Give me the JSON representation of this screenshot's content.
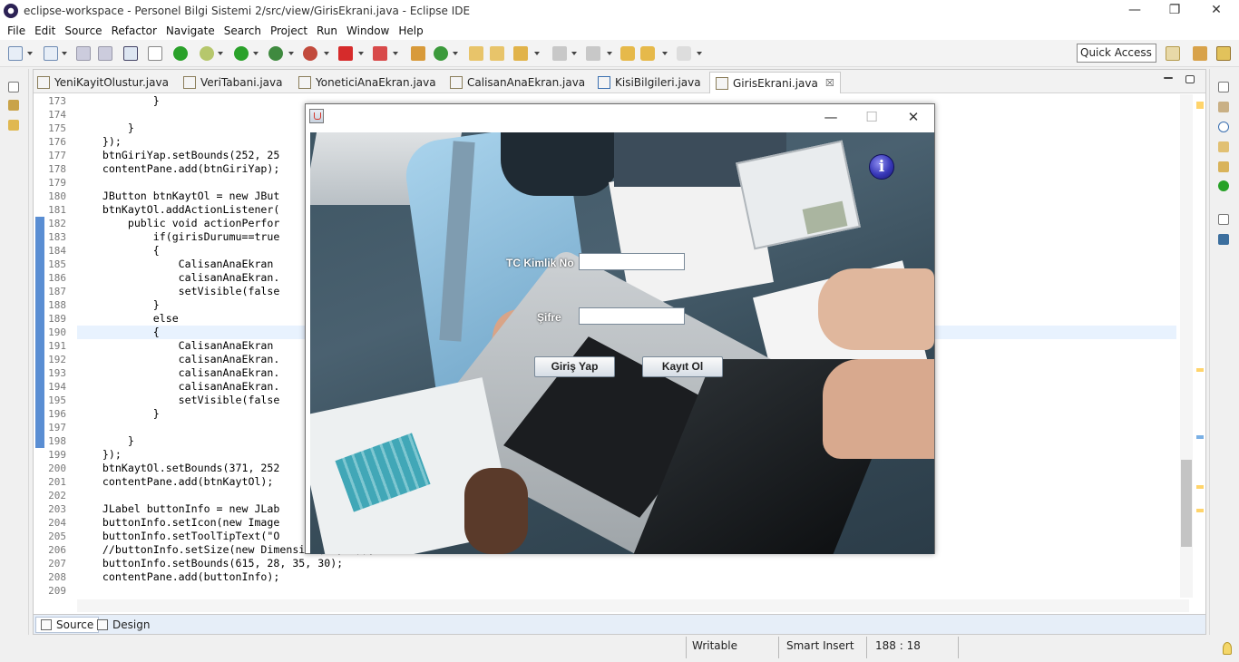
{
  "window": {
    "title": "eclipse-workspace - Personel Bilgi Sistemi 2/src/view/GirisEkrani.java - Eclipse IDE",
    "minimize": "—",
    "restore": "❐",
    "close": "✕"
  },
  "menu": [
    "File",
    "Edit",
    "Source",
    "Refactor",
    "Navigate",
    "Search",
    "Project",
    "Run",
    "Window",
    "Help"
  ],
  "toolbar": {
    "quick_access": "Quick Access"
  },
  "tabs": [
    {
      "label": "YeniKayitOlustur.java",
      "icon": "java-file-icon"
    },
    {
      "label": "VeriTabani.java",
      "icon": "java-file-icon"
    },
    {
      "label": "YoneticiAnaEkran.java",
      "icon": "java-file-icon"
    },
    {
      "label": "CalisanAnaEkran.java",
      "icon": "java-file-icon"
    },
    {
      "label": "KisiBilgileri.java",
      "icon": "java-file-icon"
    },
    {
      "label": "GirisEkrani.java",
      "icon": "java-file-icon",
      "active": true,
      "close": "☒"
    }
  ],
  "code": {
    "line_numbers": [
      "173",
      "174",
      "175",
      "176",
      "177",
      "178",
      "179",
      "180",
      "181",
      "182",
      "183",
      "184",
      "185",
      "186",
      "187",
      "188",
      "189",
      "190",
      "191",
      "192",
      "193",
      "194",
      "195",
      "196",
      "197",
      "198",
      "199",
      "200",
      "201",
      "202",
      "203",
      "204",
      "205",
      "206",
      "207",
      "208",
      "209"
    ],
    "lines": [
      "            }",
      "",
      "        }",
      "    });",
      "    btnGiriYap.setBounds(252, 25",
      "    contentPane.add(btnGiriYap);",
      "",
      "    JButton btnKaytOl = new JBut",
      "    btnKaytOl.addActionListener(",
      "        public void actionPerfor",
      "            if(girisDurumu==true",
      "            {",
      "                CalisanAnaEkran",
      "                calisanAnaEkran.",
      "                setVisible(false",
      "            }",
      "            else",
      "            {",
      "                CalisanAnaEkran",
      "                calisanAnaEkran.",
      "                calisanAnaEkran.",
      "                calisanAnaEkran.",
      "                setVisible(false",
      "            }",
      "",
      "        }",
      "    });",
      "    btnKaytOl.setBounds(371, 252",
      "    contentPane.add(btnKaytOl);",
      "",
      "    JLabel buttonInfo = new JLab",
      "    buttonInfo.setIcon(new Image",
      "    buttonInfo.setToolTipText(\"O",
      "    //buttonInfo.setSize(new Dimension(30,30));",
      "    buttonInfo.setBounds(615, 28, 35, 30);",
      "    contentPane.add(buttonInfo);",
      ""
    ]
  },
  "bottom_tabs": {
    "source": "Source",
    "design": "Design"
  },
  "status": {
    "writable": "Writable",
    "insert_mode": "Smart Insert",
    "position": "188 : 18"
  },
  "dialog": {
    "minimize": "—",
    "maximize": "☐",
    "close": "✕",
    "tc_label": "TC Kimlik No",
    "tc_value": "",
    "password_label": "Şifre",
    "password_value": "",
    "login_button": "Giriş Yap",
    "register_button": "Kayıt Ol",
    "info_icon": "i"
  }
}
